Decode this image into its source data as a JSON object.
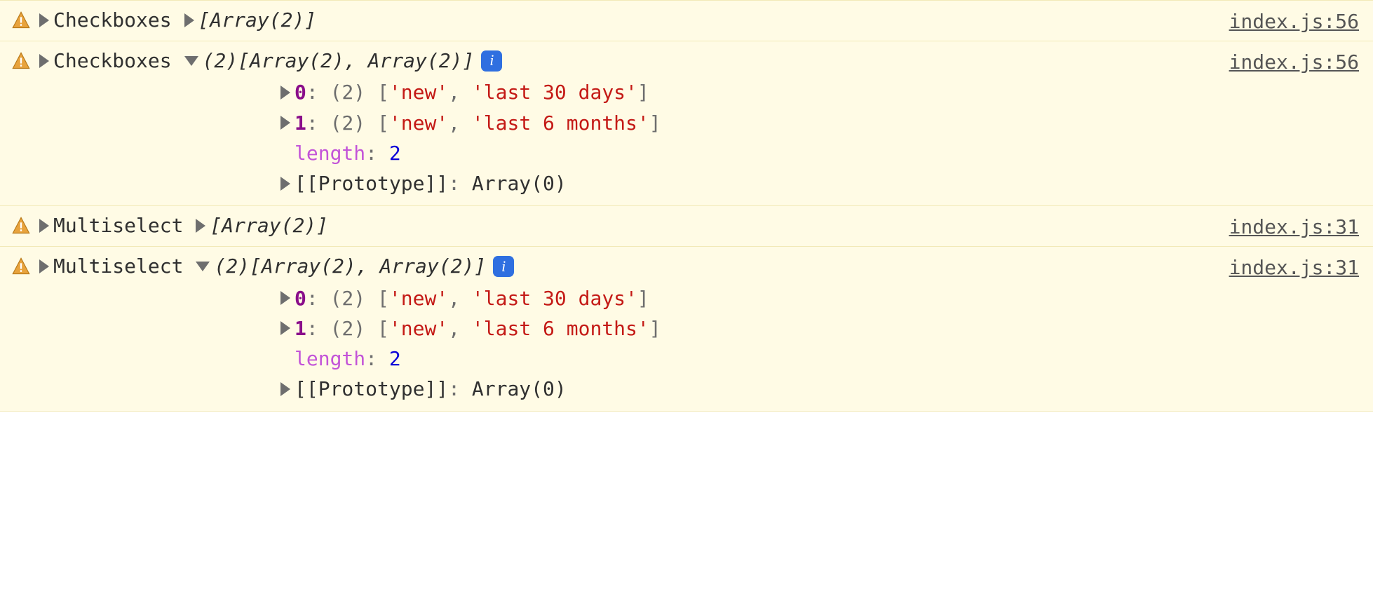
{
  "collapsed_summary": "[Array(2)]",
  "expanded_summary_prefix": "(2) ",
  "expanded_summary_body": "[Array(2), Array(2)]",
  "detail_count_prefix": "(2) ",
  "detail_bracket_open": "[",
  "detail_bracket_close": "]",
  "detail_sep": ", ",
  "length_key": "length",
  "length_val": "2",
  "proto_key": "[[Prototype]]",
  "proto_val": "Array(0)",
  "colon": ": ",
  "info_glyph": "i",
  "entries": [
    {
      "label": "Checkboxes",
      "source": "index.js:56",
      "expanded": false
    },
    {
      "label": "Checkboxes",
      "source": "index.js:56",
      "expanded": true,
      "items": [
        {
          "idx": "0",
          "v0": "'new'",
          "v1": "'last 30 days'"
        },
        {
          "idx": "1",
          "v0": "'new'",
          "v1": "'last 6 months'"
        }
      ]
    },
    {
      "label": "Multiselect",
      "source": "index.js:31",
      "expanded": false
    },
    {
      "label": "Multiselect",
      "source": "index.js:31",
      "expanded": true,
      "items": [
        {
          "idx": "0",
          "v0": "'new'",
          "v1": "'last 30 days'"
        },
        {
          "idx": "1",
          "v0": "'new'",
          "v1": "'last 6 months'"
        }
      ]
    }
  ]
}
